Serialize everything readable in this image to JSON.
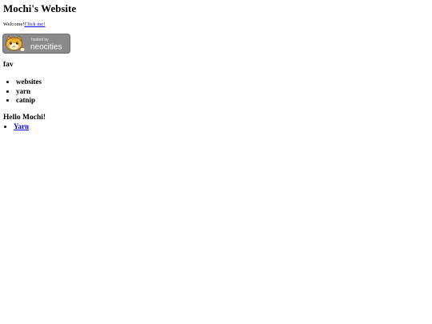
{
  "header": {
    "title": "Mochi's Website"
  },
  "welcome": {
    "text": "Welcome!",
    "link_label": "Click me!"
  },
  "badge": {
    "label_top": "hosted by",
    "label_brand": "neocities",
    "colors": {
      "background": "#8a8a8a",
      "cat_fur": "#f2b233",
      "text": "#ffffff"
    }
  },
  "favorites": {
    "heading": "fav",
    "items": [
      "websites",
      "yarn",
      "catnip"
    ]
  },
  "greeting": {
    "heading": "Hello Mochi!"
  },
  "nav": {
    "items": [
      {
        "label": "Yarn"
      }
    ]
  },
  "colors": {
    "link": "#0000ee",
    "text": "#000000",
    "background": "#ffffff"
  }
}
